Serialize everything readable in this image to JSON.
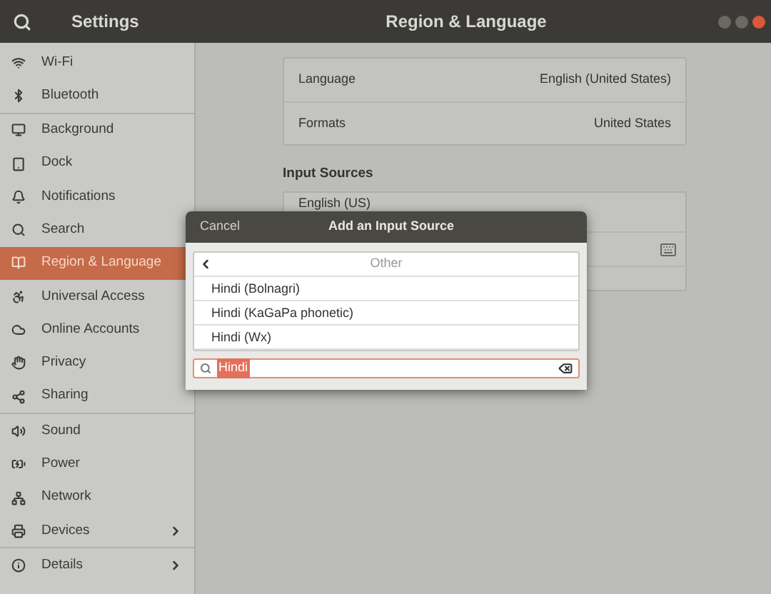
{
  "window": {
    "app_title": "Settings",
    "title": "Region & Language"
  },
  "sidebar": {
    "groups": [
      [
        {
          "label": "Wi-Fi",
          "selected": false,
          "has_submenu": false
        },
        {
          "label": "Bluetooth",
          "selected": false,
          "has_submenu": false
        }
      ],
      [
        {
          "label": "Background",
          "selected": false,
          "has_submenu": false
        },
        {
          "label": "Dock",
          "selected": false,
          "has_submenu": false
        },
        {
          "label": "Notifications",
          "selected": false,
          "has_submenu": false
        },
        {
          "label": "Search",
          "selected": false,
          "has_submenu": false
        },
        {
          "label": "Region & Language",
          "selected": true,
          "has_submenu": false
        },
        {
          "label": "Universal Access",
          "selected": false,
          "has_submenu": false
        },
        {
          "label": "Online Accounts",
          "selected": false,
          "has_submenu": false
        },
        {
          "label": "Privacy",
          "selected": false,
          "has_submenu": false
        },
        {
          "label": "Sharing",
          "selected": false,
          "has_submenu": false
        }
      ],
      [
        {
          "label": "Sound",
          "selected": false,
          "has_submenu": false
        },
        {
          "label": "Power",
          "selected": false,
          "has_submenu": false
        },
        {
          "label": "Network",
          "selected": false,
          "has_submenu": false
        },
        {
          "label": "Devices",
          "selected": false,
          "has_submenu": true
        }
      ],
      [
        {
          "label": "Details",
          "selected": false,
          "has_submenu": true
        }
      ]
    ]
  },
  "settings": [
    {
      "label": "Language",
      "value": "English (United States)"
    },
    {
      "label": "Formats",
      "value": "United States"
    }
  ],
  "input_sources": {
    "heading": "Input Sources",
    "items": [
      "English (US)"
    ]
  },
  "dialog": {
    "cancel": "Cancel",
    "title": "Add an Input Source",
    "back_label": "Other",
    "items": [
      "Hindi (Bolnagri)",
      "Hindi (KaGaPa phonetic)",
      "Hindi (Wx)"
    ],
    "search": {
      "value": "Hindi",
      "text_selected": true
    }
  }
}
